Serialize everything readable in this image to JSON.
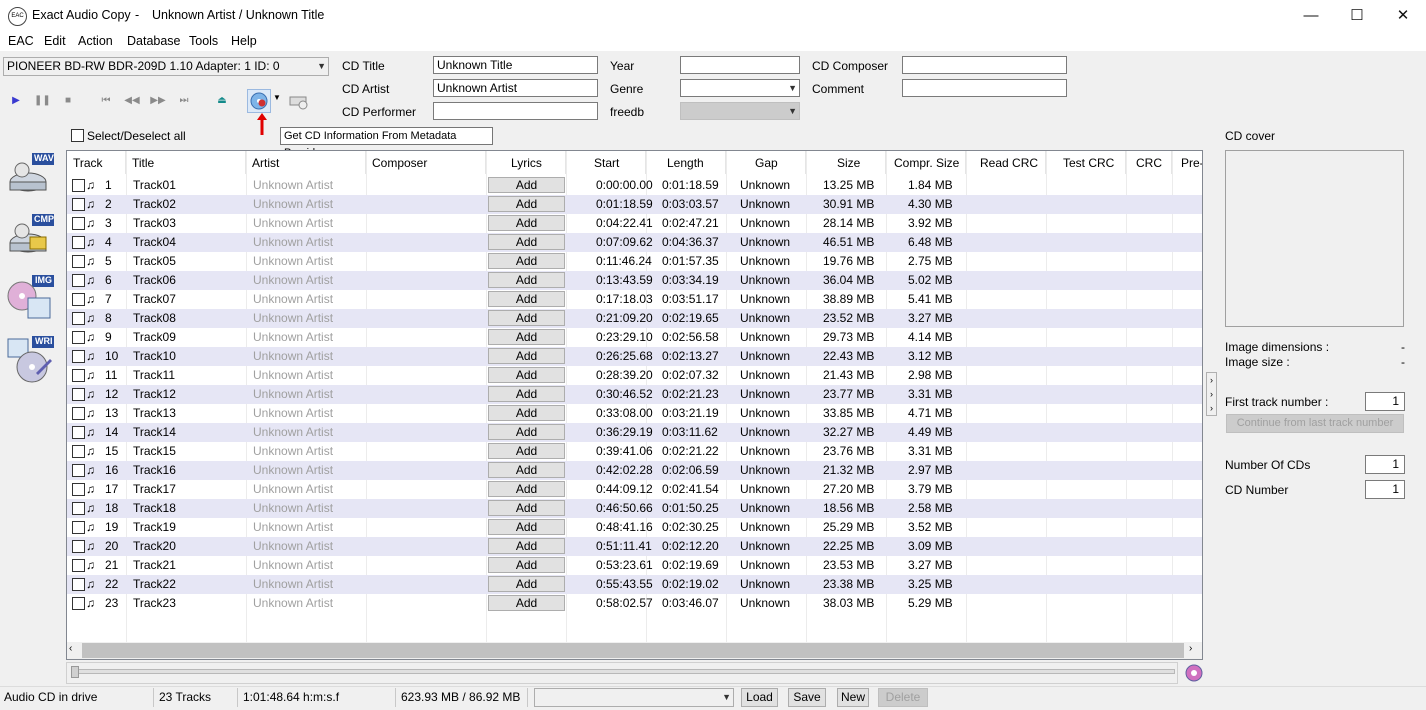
{
  "window": {
    "app_name": "Exact Audio Copy",
    "separator": "-",
    "doc_title": "Unknown Artist / Unknown Title",
    "icon_text": "EAC",
    "minimize": "—",
    "maximize": "☐",
    "close": "✕"
  },
  "menu": [
    "EAC",
    "Edit",
    "Action",
    "Database",
    "Tools",
    "Help"
  ],
  "drive": {
    "selected": "PIONEER BD-RW   BDR-209D 1.10   Adapter: 1  ID: 0"
  },
  "metadata": {
    "cd_title_label": "CD Title",
    "cd_title_value": "Unknown Title",
    "cd_artist_label": "CD Artist",
    "cd_artist_value": "Unknown Artist",
    "cd_performer_label": "CD Performer",
    "cd_performer_value": "",
    "year_label": "Year",
    "year_value": "",
    "genre_label": "Genre",
    "genre_value": "",
    "freedb_label": "freedb",
    "freedb_value": "",
    "cd_composer_label": "CD Composer",
    "cd_composer_value": "",
    "comment_label": "Comment",
    "comment_value": ""
  },
  "select_all_label": "Select/Deselect all",
  "tooltip": "Get CD Information From Metadata Provider",
  "side_icons": [
    "WAV",
    "CMP",
    "IMG",
    "WRI"
  ],
  "table": {
    "headers": [
      "Track",
      "Title",
      "Artist",
      "Composer",
      "Lyrics",
      "Start",
      "Length",
      "Gap",
      "Size",
      "Compr. Size",
      "Read CRC",
      "Test CRC",
      "CRC",
      "Pre-"
    ],
    "add_label": "Add",
    "rows": [
      {
        "n": "1",
        "title": "Track01",
        "artist": "Unknown Artist",
        "start": "0:00:00.00",
        "length": "0:01:18.59",
        "gap": "Unknown",
        "size": "13.25 MB",
        "compr": "1.84 MB"
      },
      {
        "n": "2",
        "title": "Track02",
        "artist": "Unknown Artist",
        "start": "0:01:18.59",
        "length": "0:03:03.57",
        "gap": "Unknown",
        "size": "30.91 MB",
        "compr": "4.30 MB"
      },
      {
        "n": "3",
        "title": "Track03",
        "artist": "Unknown Artist",
        "start": "0:04:22.41",
        "length": "0:02:47.21",
        "gap": "Unknown",
        "size": "28.14 MB",
        "compr": "3.92 MB"
      },
      {
        "n": "4",
        "title": "Track04",
        "artist": "Unknown Artist",
        "start": "0:07:09.62",
        "length": "0:04:36.37",
        "gap": "Unknown",
        "size": "46.51 MB",
        "compr": "6.48 MB"
      },
      {
        "n": "5",
        "title": "Track05",
        "artist": "Unknown Artist",
        "start": "0:11:46.24",
        "length": "0:01:57.35",
        "gap": "Unknown",
        "size": "19.76 MB",
        "compr": "2.75 MB"
      },
      {
        "n": "6",
        "title": "Track06",
        "artist": "Unknown Artist",
        "start": "0:13:43.59",
        "length": "0:03:34.19",
        "gap": "Unknown",
        "size": "36.04 MB",
        "compr": "5.02 MB"
      },
      {
        "n": "7",
        "title": "Track07",
        "artist": "Unknown Artist",
        "start": "0:17:18.03",
        "length": "0:03:51.17",
        "gap": "Unknown",
        "size": "38.89 MB",
        "compr": "5.41 MB"
      },
      {
        "n": "8",
        "title": "Track08",
        "artist": "Unknown Artist",
        "start": "0:21:09.20",
        "length": "0:02:19.65",
        "gap": "Unknown",
        "size": "23.52 MB",
        "compr": "3.27 MB"
      },
      {
        "n": "9",
        "title": "Track09",
        "artist": "Unknown Artist",
        "start": "0:23:29.10",
        "length": "0:02:56.58",
        "gap": "Unknown",
        "size": "29.73 MB",
        "compr": "4.14 MB"
      },
      {
        "n": "10",
        "title": "Track10",
        "artist": "Unknown Artist",
        "start": "0:26:25.68",
        "length": "0:02:13.27",
        "gap": "Unknown",
        "size": "22.43 MB",
        "compr": "3.12 MB"
      },
      {
        "n": "11",
        "title": "Track11",
        "artist": "Unknown Artist",
        "start": "0:28:39.20",
        "length": "0:02:07.32",
        "gap": "Unknown",
        "size": "21.43 MB",
        "compr": "2.98 MB"
      },
      {
        "n": "12",
        "title": "Track12",
        "artist": "Unknown Artist",
        "start": "0:30:46.52",
        "length": "0:02:21.23",
        "gap": "Unknown",
        "size": "23.77 MB",
        "compr": "3.31 MB"
      },
      {
        "n": "13",
        "title": "Track13",
        "artist": "Unknown Artist",
        "start": "0:33:08.00",
        "length": "0:03:21.19",
        "gap": "Unknown",
        "size": "33.85 MB",
        "compr": "4.71 MB"
      },
      {
        "n": "14",
        "title": "Track14",
        "artist": "Unknown Artist",
        "start": "0:36:29.19",
        "length": "0:03:11.62",
        "gap": "Unknown",
        "size": "32.27 MB",
        "compr": "4.49 MB"
      },
      {
        "n": "15",
        "title": "Track15",
        "artist": "Unknown Artist",
        "start": "0:39:41.06",
        "length": "0:02:21.22",
        "gap": "Unknown",
        "size": "23.76 MB",
        "compr": "3.31 MB"
      },
      {
        "n": "16",
        "title": "Track16",
        "artist": "Unknown Artist",
        "start": "0:42:02.28",
        "length": "0:02:06.59",
        "gap": "Unknown",
        "size": "21.32 MB",
        "compr": "2.97 MB"
      },
      {
        "n": "17",
        "title": "Track17",
        "artist": "Unknown Artist",
        "start": "0:44:09.12",
        "length": "0:02:41.54",
        "gap": "Unknown",
        "size": "27.20 MB",
        "compr": "3.79 MB"
      },
      {
        "n": "18",
        "title": "Track18",
        "artist": "Unknown Artist",
        "start": "0:46:50.66",
        "length": "0:01:50.25",
        "gap": "Unknown",
        "size": "18.56 MB",
        "compr": "2.58 MB"
      },
      {
        "n": "19",
        "title": "Track19",
        "artist": "Unknown Artist",
        "start": "0:48:41.16",
        "length": "0:02:30.25",
        "gap": "Unknown",
        "size": "25.29 MB",
        "compr": "3.52 MB"
      },
      {
        "n": "20",
        "title": "Track20",
        "artist": "Unknown Artist",
        "start": "0:51:11.41",
        "length": "0:02:12.20",
        "gap": "Unknown",
        "size": "22.25 MB",
        "compr": "3.09 MB"
      },
      {
        "n": "21",
        "title": "Track21",
        "artist": "Unknown Artist",
        "start": "0:53:23.61",
        "length": "0:02:19.69",
        "gap": "Unknown",
        "size": "23.53 MB",
        "compr": "3.27 MB"
      },
      {
        "n": "22",
        "title": "Track22",
        "artist": "Unknown Artist",
        "start": "0:55:43.55",
        "length": "0:02:19.02",
        "gap": "Unknown",
        "size": "23.38 MB",
        "compr": "3.25 MB"
      },
      {
        "n": "23",
        "title": "Track23",
        "artist": "Unknown Artist",
        "start": "0:58:02.57",
        "length": "0:03:46.07",
        "gap": "Unknown",
        "size": "38.03 MB",
        "compr": "5.29 MB"
      }
    ]
  },
  "right_panel": {
    "cd_cover_label": "CD cover",
    "image_dimensions_label": "Image dimensions :",
    "image_dimensions_value": "-",
    "image_size_label": "Image size :",
    "image_size_value": "-",
    "first_track_label": "First track number :",
    "first_track_value": "1",
    "continue_label": "Continue from last track number",
    "num_cds_label": "Number Of CDs",
    "num_cds_value": "1",
    "cd_number_label": "CD Number",
    "cd_number_value": "1"
  },
  "status": {
    "drive_status": "Audio CD in drive",
    "tracks": "23 Tracks",
    "duration": "1:01:48.64 h:m:s.f",
    "size": "623.93 MB /  86.92 MB",
    "profile_value": "",
    "load": "Load",
    "save": "Save",
    "new": "New",
    "delete": "Delete"
  },
  "colors": {
    "row_alt": "#e6e6f5",
    "accent_red": "#e00000",
    "disabled_text": "#a0a0a0"
  }
}
